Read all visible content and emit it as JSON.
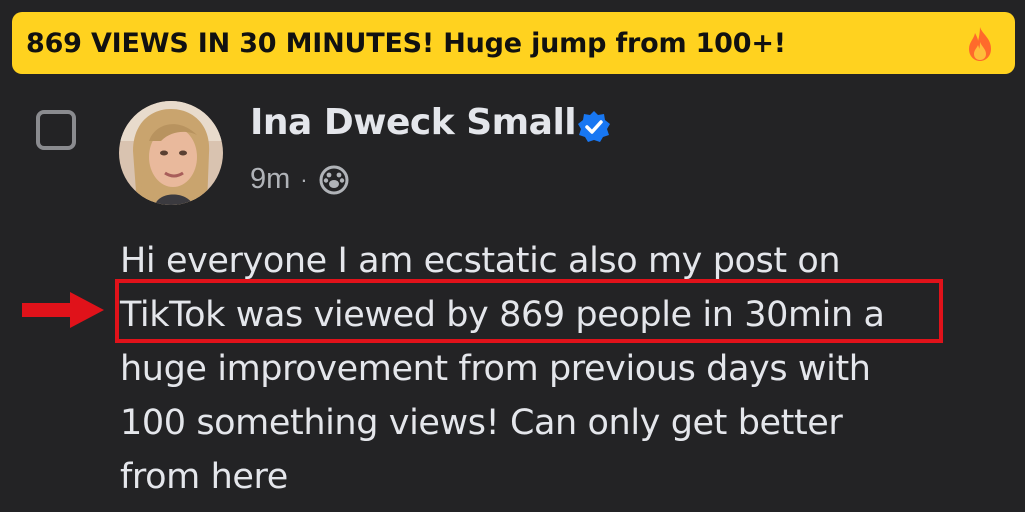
{
  "banner": {
    "text": "869 VIEWS IN 30 MINUTES! Huge jump from 100+!",
    "icon": "fire-icon",
    "background_color": "#ffd21f"
  },
  "post": {
    "author": "Ina Dweck Small",
    "verified_icon": "verified-badge-icon",
    "timestamp": "9m",
    "separator": "·",
    "audience_icon": "audience-icon",
    "text_lines": [
      "Hi everyone I am ecstatic also my post on",
      "TikTok was viewed by 869 people in 30min a",
      "huge improvement from previous days with",
      "100 something views! Can only get better",
      "from here"
    ]
  },
  "annotation": {
    "highlight_color": "#e0121a",
    "arrow_icon": "red-arrow-icon"
  }
}
